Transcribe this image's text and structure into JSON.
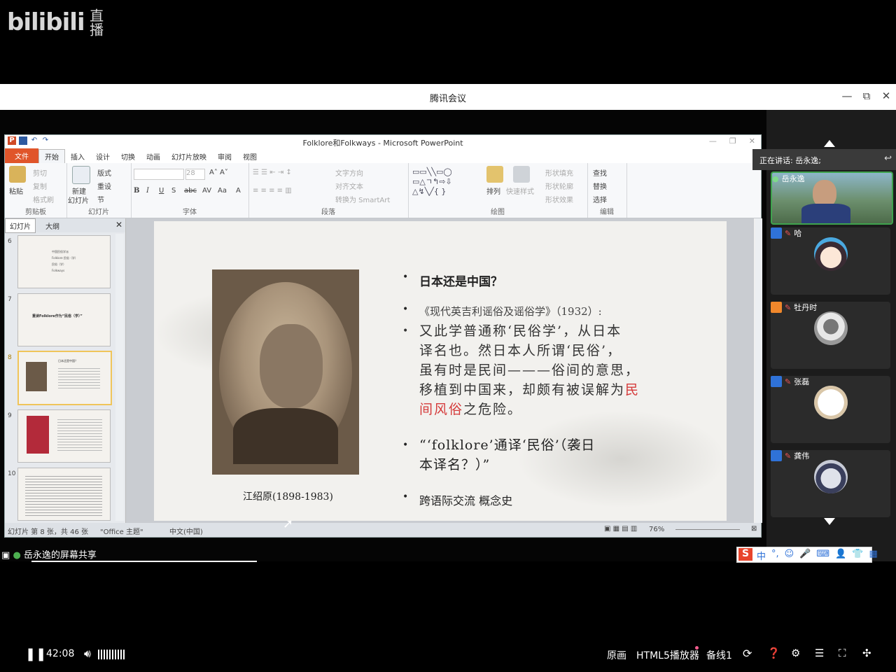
{
  "bilibili": {
    "logo_text": "bilibili",
    "live": "直播"
  },
  "window": {
    "title": "腾讯会议",
    "controls": [
      "—",
      "⧉",
      "✕"
    ]
  },
  "ppt": {
    "title": "Folklore和Folkways - Microsoft PowerPoint",
    "tabs": [
      "文件",
      "开始",
      "插入",
      "设计",
      "切换",
      "动画",
      "幻灯片放映",
      "审阅",
      "视图"
    ],
    "ribbon": {
      "clipboard": {
        "paste": "粘贴",
        "cut": "剪切",
        "copy": "复制",
        "format_painter": "格式刷",
        "label": "剪贴板"
      },
      "slides": {
        "new_slide": "新建",
        "new_slide2": "幻灯片",
        "layout": "版式",
        "reset": "重设",
        "section": "节",
        "label": "幻灯片"
      },
      "font": {
        "size": "28",
        "label": "字体"
      },
      "paragraph": {
        "text_direction": "文字方向",
        "align_text": "对齐文本",
        "smartart": "转换为 SmartArt",
        "label": "段落"
      },
      "drawing": {
        "arrange": "排列",
        "quick_styles": "快速样式",
        "shape_fill": "形状填充",
        "shape_outline": "形状轮廓",
        "shape_effects": "形状效果",
        "label": "绘图"
      },
      "editing": {
        "find": "查找",
        "replace": "替换",
        "select": "选择",
        "label": "编辑"
      }
    },
    "panel_tabs": [
      "幻灯片",
      "大纲"
    ],
    "thumbs": [
      {
        "num": "6",
        "lines": [
          "中国民俗学派",
          "Folklore 民俗（学）",
          "民俗（学）",
          "Folkways"
        ]
      },
      {
        "num": "7",
        "lines": [
          "重读Folklore作为“民俗（学）”"
        ]
      },
      {
        "num": "8",
        "lines": [
          "日本还是中国？"
        ]
      },
      {
        "num": "9",
        "lines": []
      },
      {
        "num": "10",
        "lines": []
      }
    ],
    "slide": {
      "caption": "江绍原(1898-1983)",
      "b1": "日本还是中国？",
      "b2": "《现代英吉利谣俗及谣俗学》（1932）:",
      "b3_lines": [
        "又此学普通称‘民俗学’，从日本",
        "译名也。然日本人所谓‘民俗’，",
        "虽有时是民间———俗间的意思，",
        "移植到中国来，却颇有被误解为"
      ],
      "b3_red1": "民",
      "b3_red2": "间风俗",
      "b3_tail": "之危险。",
      "b4_line1": "“‘folklore’通译‘民俗’（袭日",
      "b4_line2": "本译名？）”",
      "b5": "跨语际交流  概念史"
    },
    "status": {
      "slide_info": "幻灯片 第 8 张，共 46 张",
      "theme": "\"Office 主题\"",
      "lang": "中文(中国)",
      "zoom": "76%"
    }
  },
  "share": {
    "label": "岳永逸的屏幕共享"
  },
  "ime": {
    "items": [
      "中",
      "°,",
      "☺",
      "🎤",
      "⌨",
      "👤",
      "👕",
      "▦"
    ]
  },
  "meeting": {
    "speaking": "正在讲话: 岳永逸;",
    "participants": [
      {
        "name": "岳永逸",
        "type": "video"
      },
      {
        "name": "哈",
        "type": "avatar"
      },
      {
        "name": "牡丹时",
        "type": "avatar"
      },
      {
        "name": "张磊",
        "type": "avatar"
      },
      {
        "name": "龚伟",
        "type": "avatar"
      }
    ]
  },
  "player": {
    "time": "42:08",
    "quality": "原画",
    "player_type": "HTML5播放器",
    "line": "备线1"
  }
}
